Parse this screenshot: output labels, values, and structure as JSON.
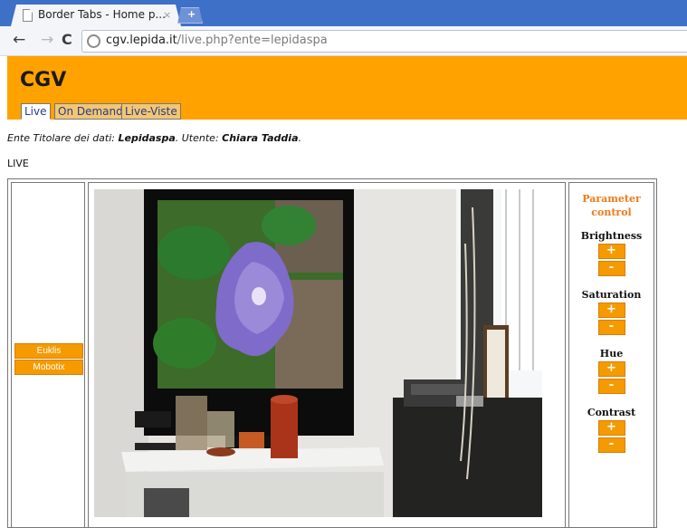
{
  "browser": {
    "tab_title": "Border Tabs - Home p...",
    "tab_close": "×",
    "new_tab": "+",
    "back": "←",
    "forward": "→",
    "reload": "C",
    "url_host": "cgv.lepida.it",
    "url_path": "/live.php?ente=lepidaspa"
  },
  "site": {
    "title": "CGV",
    "tabs": [
      {
        "label": "Live",
        "active": true
      },
      {
        "label": "On Demand",
        "active": false
      },
      {
        "label": "Live-Viste",
        "active": false
      }
    ],
    "owner_prefix": "Ente Titolare dei dati: ",
    "owner_name": "Lepidaspa",
    "user_prefix": ".  Utente: ",
    "user_name": "Chiara Taddia",
    "user_suffix": ".",
    "section_label": "LIVE"
  },
  "cameras": [
    "Euklis",
    "Mobotix"
  ],
  "parameters": {
    "title": "Parameter control",
    "groups": [
      {
        "label": "Brightness",
        "plus": "+",
        "minus": "-"
      },
      {
        "label": "Saturation",
        "plus": "+",
        "minus": "-"
      },
      {
        "label": "Hue",
        "plus": "+",
        "minus": "-"
      },
      {
        "label": "Contrast",
        "plus": "+",
        "minus": "-"
      }
    ]
  },
  "colors": {
    "brand_orange": "#ffa200",
    "button_orange": "#f59a00",
    "chrome_blue": "#3e70c7",
    "param_title": "#ef7a1a"
  }
}
